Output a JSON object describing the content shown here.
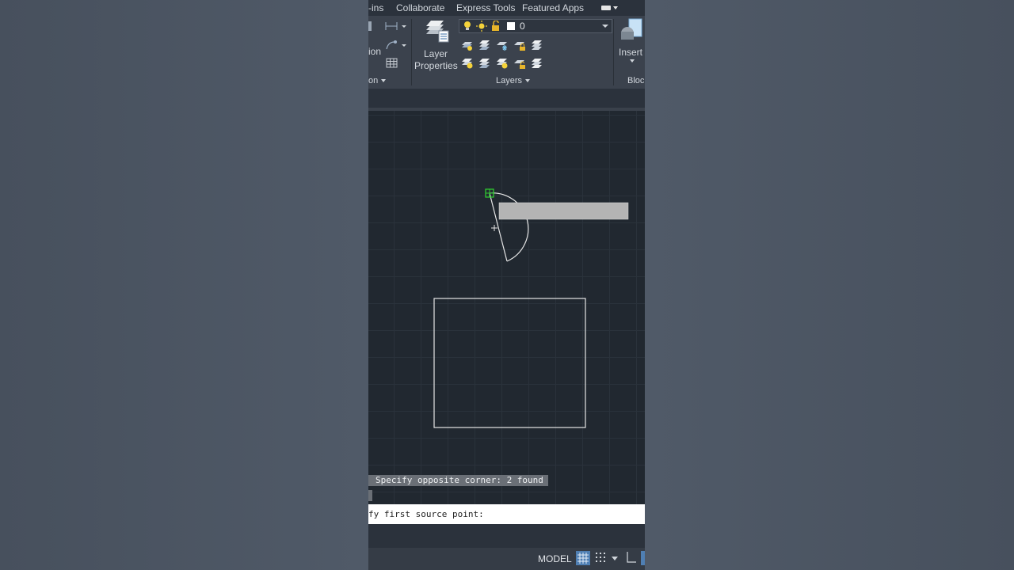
{
  "ribbon_tabs": {
    "addins": "-ins",
    "collaborate": "Collaborate",
    "express_tools": "Express Tools",
    "featured_apps": "Featured Apps"
  },
  "ribbon": {
    "annotation_partial_label": "ion",
    "annotation_footer_partial": "on",
    "layer_properties_line1": "Layer",
    "layer_properties_line2": "Properties",
    "layer_combo_value": "0",
    "layers_panel_label": "Layers",
    "insert_label": "Insert",
    "block_panel_partial": "Bloc"
  },
  "command": {
    "history_line": "Specify opposite corner: 2 found",
    "prompt_partial": "fy first source point:"
  },
  "status_bar": {
    "model_label": "MODEL"
  },
  "colors": {
    "canvas_bg": "#212830",
    "grid_line": "#2a323b",
    "geometry_stroke": "#e6e6e6",
    "grip_green": "#2fd12f",
    "tooltip_gray": "#b4b4b4",
    "status_accent": "#4f7fb3"
  },
  "icons": {
    "dimension": "linear-dimension-icon",
    "leader": "leader-icon",
    "table": "table-icon",
    "layer_properties": "layer-stack-icon",
    "lightbulb": "lightbulb-icon",
    "sun": "sun-icon",
    "lock": "padlock-icon",
    "insert_block": "insert-block-icon",
    "grid": "grid-icon",
    "snap": "snap-icon",
    "ortho": "ortho-icon"
  }
}
